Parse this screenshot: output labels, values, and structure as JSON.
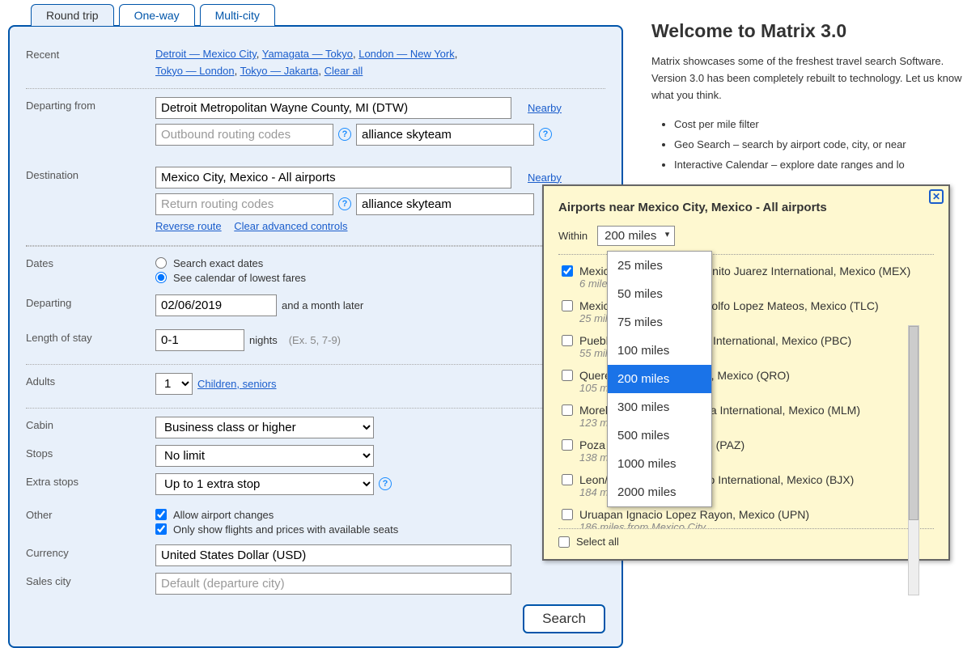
{
  "tabs": {
    "round_trip": "Round trip",
    "one_way": "One-way",
    "multi_city": "Multi-city"
  },
  "labels": {
    "recent": "Recent",
    "departing_from": "Departing from",
    "destination": "Destination",
    "dates": "Dates",
    "departing": "Departing",
    "length_of_stay": "Length of stay",
    "adults": "Adults",
    "cabin": "Cabin",
    "stops": "Stops",
    "extra_stops": "Extra stops",
    "other": "Other",
    "currency": "Currency",
    "sales_city": "Sales city",
    "nearby": "Nearby",
    "reverse": "Reverse route",
    "clear_adv": "Clear advanced controls",
    "children": "Children, seniors",
    "nights": "nights",
    "nights_hint": "(Ex. 5, 7-9)",
    "and_month": "and a month later",
    "select_all": "Select all"
  },
  "recent": [
    "Detroit — Mexico City",
    "Yamagata — Tokyo",
    "London — New York",
    "Tokyo — London",
    "Tokyo — Jakarta",
    "Clear all"
  ],
  "departing": {
    "value": "Detroit Metropolitan Wayne County, MI (DTW)",
    "outbound_placeholder": "Outbound routing codes",
    "alliance": "alliance skyteam"
  },
  "destination": {
    "value": "Mexico City, Mexico - All airports",
    "return_placeholder": "Return routing codes",
    "alliance": "alliance skyteam"
  },
  "dates": {
    "exact": "Search exact dates",
    "calendar": "See calendar of lowest fares",
    "departing_value": "02/06/2019",
    "stay_value": "0-1"
  },
  "adults_value": "1",
  "cabin_value": "Business class or higher",
  "stops_value": "No limit",
  "extra_stops_value": "Up to 1 extra stop",
  "other_opts": {
    "airport_changes": "Allow airport changes",
    "available_seats": "Only show flights and prices with available seats"
  },
  "currency_value": "United States Dollar (USD)",
  "sales_city_placeholder": "Default (departure city)",
  "search_label": "Search",
  "welcome": {
    "title": "Welcome to Matrix 3.0",
    "para": "Matrix showcases some of the freshest travel search Software. Version 3.0 has been completely rebuilt to technology. Let us know what you think.",
    "bullets": [
      "Cost per mile filter",
      "Geo Search – search by airport code, city, or near",
      "Interactive Calendar – explore date ranges and lo"
    ]
  },
  "popup": {
    "title": "Airports near Mexico City, Mexico - All airports",
    "within": "Within",
    "within_value": "200 miles",
    "options": [
      "25 miles",
      "50 miles",
      "75 miles",
      "100 miles",
      "200 miles",
      "300 miles",
      "500 miles",
      "1000 miles",
      "2000 miles"
    ],
    "airports": [
      {
        "name": "Mexico City Licenciado Benito Juarez International, Mexico (MEX)",
        "dist": "6 miles",
        "checked": true
      },
      {
        "name": "Mexico City Licenciado Adolfo Lopez Mateos, Mexico (TLC)",
        "dist": "25 miles from Mexico City"
      },
      {
        "name": "Puebla Hermanos Serdan International, Mexico (PBC)",
        "dist": "55 miles from Mexico City"
      },
      {
        "name": "Queretaro Intercontinental, Mexico (QRO)",
        "dist": "105 miles from Mexico City"
      },
      {
        "name": "Morelia Francisco J. Mujica International, Mexico (MLM)",
        "dist": "123 miles from Mexico City"
      },
      {
        "name": "Poza Rica El Tajin, Mexico (PAZ)",
        "dist": "138 miles from Mexico City"
      },
      {
        "name": "Leon/Guanajuato Del Bajio International, Mexico (BJX)",
        "dist": "184 miles from Mexico City"
      },
      {
        "name": "Uruapan Ignacio Lopez Rayon, Mexico (UPN)",
        "dist": "186 miles from Mexico City"
      }
    ]
  }
}
